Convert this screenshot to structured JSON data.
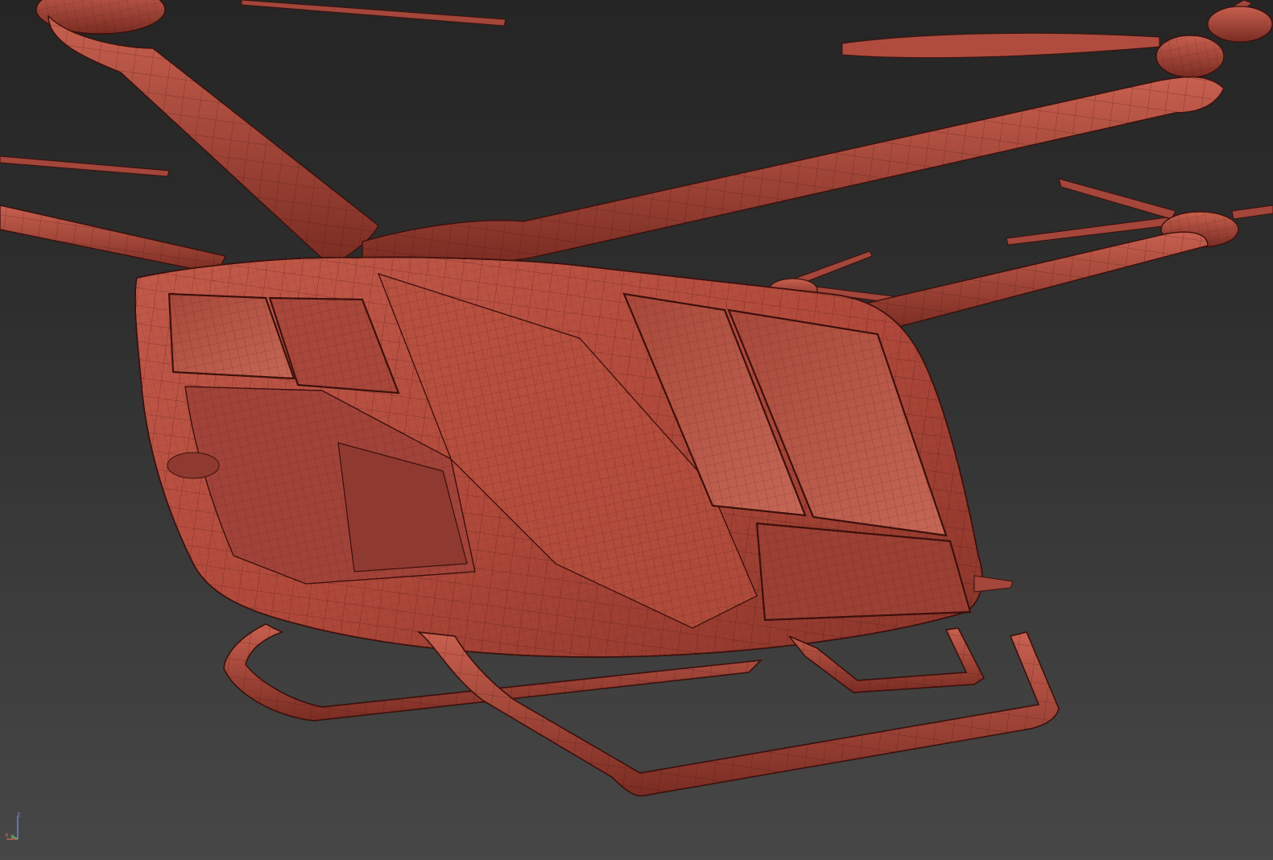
{
  "viewport": {
    "background_top": "#252525",
    "background_bottom": "#474747",
    "shading": "wireframe-on-shaded"
  },
  "model": {
    "surface_color": "#b24a3c",
    "highlight_color": "#c8604f",
    "shadow_color": "#6a2520",
    "wire_color": "#3a100c"
  },
  "axis_gizmo": {
    "z_label": "z",
    "x_label": "x",
    "y_label": "y",
    "z_color": "#6f8fd8",
    "x_color": "#d86060",
    "y_color": "#60c060"
  }
}
